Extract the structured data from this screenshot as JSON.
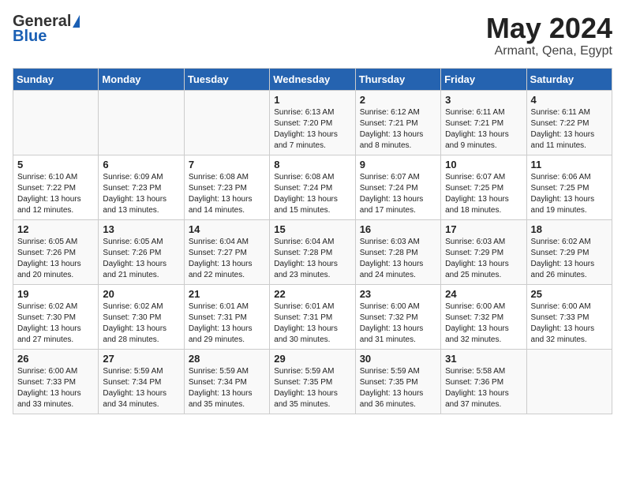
{
  "header": {
    "logo_general": "General",
    "logo_blue": "Blue",
    "month_year": "May 2024",
    "location": "Armant, Qena, Egypt"
  },
  "calendar": {
    "weekdays": [
      "Sunday",
      "Monday",
      "Tuesday",
      "Wednesday",
      "Thursday",
      "Friday",
      "Saturday"
    ],
    "weeks": [
      [
        {
          "day": "",
          "info": ""
        },
        {
          "day": "",
          "info": ""
        },
        {
          "day": "",
          "info": ""
        },
        {
          "day": "1",
          "info": "Sunrise: 6:13 AM\nSunset: 7:20 PM\nDaylight: 13 hours\nand 7 minutes."
        },
        {
          "day": "2",
          "info": "Sunrise: 6:12 AM\nSunset: 7:21 PM\nDaylight: 13 hours\nand 8 minutes."
        },
        {
          "day": "3",
          "info": "Sunrise: 6:11 AM\nSunset: 7:21 PM\nDaylight: 13 hours\nand 9 minutes."
        },
        {
          "day": "4",
          "info": "Sunrise: 6:11 AM\nSunset: 7:22 PM\nDaylight: 13 hours\nand 11 minutes."
        }
      ],
      [
        {
          "day": "5",
          "info": "Sunrise: 6:10 AM\nSunset: 7:22 PM\nDaylight: 13 hours\nand 12 minutes."
        },
        {
          "day": "6",
          "info": "Sunrise: 6:09 AM\nSunset: 7:23 PM\nDaylight: 13 hours\nand 13 minutes."
        },
        {
          "day": "7",
          "info": "Sunrise: 6:08 AM\nSunset: 7:23 PM\nDaylight: 13 hours\nand 14 minutes."
        },
        {
          "day": "8",
          "info": "Sunrise: 6:08 AM\nSunset: 7:24 PM\nDaylight: 13 hours\nand 15 minutes."
        },
        {
          "day": "9",
          "info": "Sunrise: 6:07 AM\nSunset: 7:24 PM\nDaylight: 13 hours\nand 17 minutes."
        },
        {
          "day": "10",
          "info": "Sunrise: 6:07 AM\nSunset: 7:25 PM\nDaylight: 13 hours\nand 18 minutes."
        },
        {
          "day": "11",
          "info": "Sunrise: 6:06 AM\nSunset: 7:25 PM\nDaylight: 13 hours\nand 19 minutes."
        }
      ],
      [
        {
          "day": "12",
          "info": "Sunrise: 6:05 AM\nSunset: 7:26 PM\nDaylight: 13 hours\nand 20 minutes."
        },
        {
          "day": "13",
          "info": "Sunrise: 6:05 AM\nSunset: 7:26 PM\nDaylight: 13 hours\nand 21 minutes."
        },
        {
          "day": "14",
          "info": "Sunrise: 6:04 AM\nSunset: 7:27 PM\nDaylight: 13 hours\nand 22 minutes."
        },
        {
          "day": "15",
          "info": "Sunrise: 6:04 AM\nSunset: 7:28 PM\nDaylight: 13 hours\nand 23 minutes."
        },
        {
          "day": "16",
          "info": "Sunrise: 6:03 AM\nSunset: 7:28 PM\nDaylight: 13 hours\nand 24 minutes."
        },
        {
          "day": "17",
          "info": "Sunrise: 6:03 AM\nSunset: 7:29 PM\nDaylight: 13 hours\nand 25 minutes."
        },
        {
          "day": "18",
          "info": "Sunrise: 6:02 AM\nSunset: 7:29 PM\nDaylight: 13 hours\nand 26 minutes."
        }
      ],
      [
        {
          "day": "19",
          "info": "Sunrise: 6:02 AM\nSunset: 7:30 PM\nDaylight: 13 hours\nand 27 minutes."
        },
        {
          "day": "20",
          "info": "Sunrise: 6:02 AM\nSunset: 7:30 PM\nDaylight: 13 hours\nand 28 minutes."
        },
        {
          "day": "21",
          "info": "Sunrise: 6:01 AM\nSunset: 7:31 PM\nDaylight: 13 hours\nand 29 minutes."
        },
        {
          "day": "22",
          "info": "Sunrise: 6:01 AM\nSunset: 7:31 PM\nDaylight: 13 hours\nand 30 minutes."
        },
        {
          "day": "23",
          "info": "Sunrise: 6:00 AM\nSunset: 7:32 PM\nDaylight: 13 hours\nand 31 minutes."
        },
        {
          "day": "24",
          "info": "Sunrise: 6:00 AM\nSunset: 7:32 PM\nDaylight: 13 hours\nand 32 minutes."
        },
        {
          "day": "25",
          "info": "Sunrise: 6:00 AM\nSunset: 7:33 PM\nDaylight: 13 hours\nand 32 minutes."
        }
      ],
      [
        {
          "day": "26",
          "info": "Sunrise: 6:00 AM\nSunset: 7:33 PM\nDaylight: 13 hours\nand 33 minutes."
        },
        {
          "day": "27",
          "info": "Sunrise: 5:59 AM\nSunset: 7:34 PM\nDaylight: 13 hours\nand 34 minutes."
        },
        {
          "day": "28",
          "info": "Sunrise: 5:59 AM\nSunset: 7:34 PM\nDaylight: 13 hours\nand 35 minutes."
        },
        {
          "day": "29",
          "info": "Sunrise: 5:59 AM\nSunset: 7:35 PM\nDaylight: 13 hours\nand 35 minutes."
        },
        {
          "day": "30",
          "info": "Sunrise: 5:59 AM\nSunset: 7:35 PM\nDaylight: 13 hours\nand 36 minutes."
        },
        {
          "day": "31",
          "info": "Sunrise: 5:58 AM\nSunset: 7:36 PM\nDaylight: 13 hours\nand 37 minutes."
        },
        {
          "day": "",
          "info": ""
        }
      ]
    ]
  }
}
